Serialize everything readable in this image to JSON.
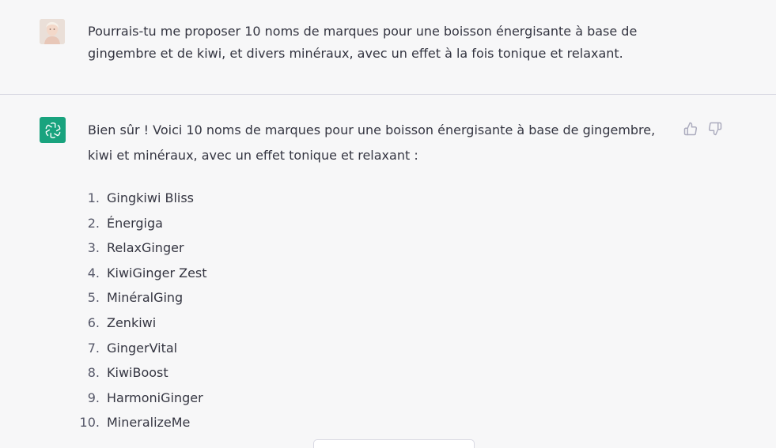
{
  "user_message": {
    "text": "Pourrais-tu me proposer 10 noms de marques pour une boisson énergisante à base de gingembre et de kiwi, et divers minéraux, avec un effet à la fois tonique et relaxant."
  },
  "assistant_message": {
    "intro": "Bien sûr ! Voici 10 noms de marques pour une boisson énergisante à base de gingembre, kiwi et minéraux, avec un effet tonique et relaxant :",
    "items": [
      {
        "num": "1.",
        "name": "Gingkiwi Bliss"
      },
      {
        "num": "2.",
        "name": "Énergiga"
      },
      {
        "num": "3.",
        "name": "RelaxGinger"
      },
      {
        "num": "4.",
        "name": "KiwiGinger Zest"
      },
      {
        "num": "5.",
        "name": "MinéralGing"
      },
      {
        "num": "6.",
        "name": "Zenkiwi"
      },
      {
        "num": "7.",
        "name": "GingerVital"
      },
      {
        "num": "8.",
        "name": "KiwiBoost"
      },
      {
        "num": "9.",
        "name": "HarmoniGinger"
      },
      {
        "num": "10.",
        "name": "MineralizeMe"
      }
    ]
  },
  "icons": {
    "user_avatar": "user-avatar",
    "assistant_avatar": "openai-logo-icon",
    "like": "thumbs-up-icon",
    "dislike": "thumbs-down-icon"
  },
  "colors": {
    "background": "#f7f7f8",
    "assistant_avatar_bg": "#19a37e",
    "text": "#343541",
    "icon": "#acacbe",
    "divider": "#d9d9e3"
  }
}
